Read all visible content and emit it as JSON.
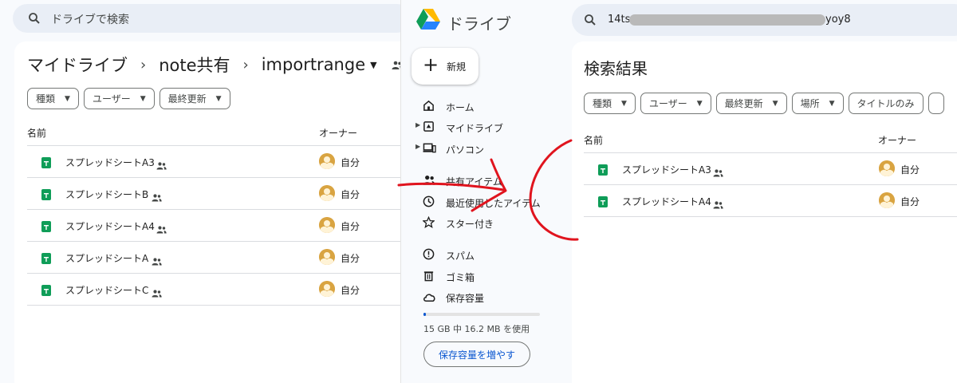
{
  "left_window": {
    "search_placeholder": "ドライブで検索",
    "breadcrumb": [
      "マイドライブ",
      "note共有",
      "importrange"
    ],
    "filters": [
      "種類",
      "ユーザー",
      "最終更新"
    ],
    "columns": {
      "name": "名前",
      "owner": "オーナー"
    },
    "files": [
      {
        "name": "スプレッドシートA3",
        "owner": "自分"
      },
      {
        "name": "スプレッドシートB",
        "owner": "自分"
      },
      {
        "name": "スプレッドシートA4",
        "owner": "自分"
      },
      {
        "name": "スプレッドシートA",
        "owner": "自分"
      },
      {
        "name": "スプレッドシートC",
        "owner": "自分"
      }
    ]
  },
  "sidebar": {
    "app_name": "ドライブ",
    "new_button": "新規",
    "nav": [
      "ホーム",
      "マイドライブ",
      "パソコン",
      "共有アイテム",
      "最近使用したアイテム",
      "スター付き",
      "スパム",
      "ゴミ箱",
      "保存容量"
    ],
    "storage_used_fraction": 0.001,
    "storage_text": "15 GB 中 16.2 MB を使用",
    "storage_button": "保存容量を増やす"
  },
  "right_window": {
    "search_prefix": "14tsr",
    "search_suffix": "yoy8",
    "title": "検索結果",
    "filters": [
      "種類",
      "ユーザー",
      "最終更新",
      "場所",
      "タイトルのみ"
    ],
    "columns": {
      "name": "名前",
      "owner": "オーナー"
    },
    "files": [
      {
        "name": "スプレッドシートA3",
        "owner": "自分"
      },
      {
        "name": "スプレッドシートA4",
        "owner": "自分"
      }
    ]
  },
  "colors": {
    "sheets_green": "#0f9d58",
    "annotation_red": "#e0141e",
    "link_blue": "#0b57d0"
  }
}
